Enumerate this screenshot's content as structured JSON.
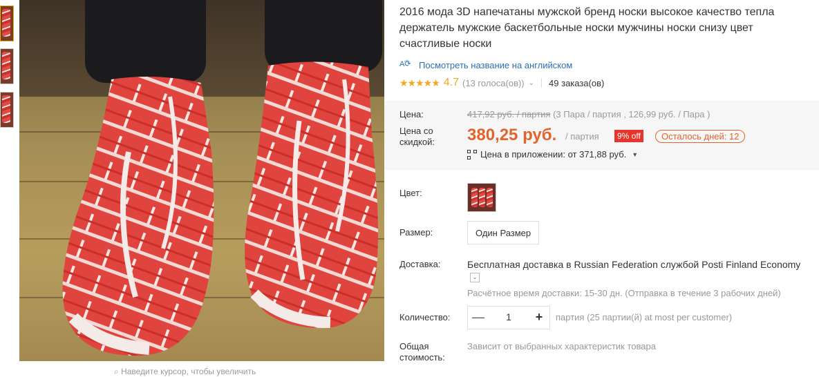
{
  "gallery": {
    "zoom_hint": "Наведите курсор, чтобы увеличить"
  },
  "product": {
    "title": "2016 мода 3D напечатаны мужской бренд носки высокое качество тепла держатель мужские баскетбольные носки мужчины носки снизу цвет счастливые носки",
    "translate_link": "Посмотреть название на английском",
    "translate_icon": "translate-icon",
    "rating_stars": "★★★★★",
    "rating_value": "4.7",
    "votes": "(13 голоса(ов))",
    "orders": "49 заказа(ов)"
  },
  "price": {
    "price_label": "Цена:",
    "old_price": "417,92 руб. / партия",
    "old_price_detail": "(3 Пара / партия , 126,99 руб. / Пара )",
    "discount_label": "Цена со скидкой:",
    "new_price": "380,25 руб.",
    "per_lot": "/ партия",
    "discount_badge": "9% off",
    "days_left": "Осталось дней: 12",
    "app_price": "Цена в приложении: от 371,88 руб."
  },
  "options": {
    "color_label": "Цвет:",
    "size_label": "Размер:",
    "size_value": "Один Размер",
    "shipping_label": "Доставка:",
    "shipping_text": "Бесплатная доставка в Russian Federation службой Posti Finland Economy",
    "shipping_estimate": "Расчётное время доставки: 15-30 дн. (Отправка в течение 3 рабочих дней)",
    "quantity_label": "Количество:",
    "quantity_value": "1",
    "quantity_note": "партия (25 партии(й) at most per customer)",
    "total_label": "Общая стоимость:",
    "total_value": "Зависит от выбранных характеристик товара"
  },
  "colors": {
    "accent": "#e2632b",
    "discount_bg": "#e5352c",
    "link": "#2a6fb6",
    "star": "#f5a623"
  }
}
